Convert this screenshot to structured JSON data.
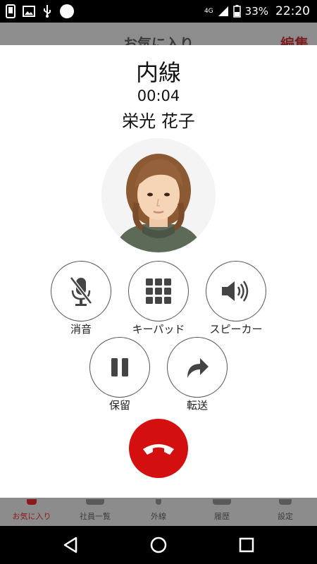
{
  "status_bar": {
    "network": "4G",
    "battery": "33%",
    "time": "22:20"
  },
  "background_app": {
    "title": "お気に入り",
    "edit_label": "編集",
    "nav": [
      {
        "label": "お気に入り",
        "active": true
      },
      {
        "label": "社員一覧",
        "active": false
      },
      {
        "label": "外線",
        "active": false
      },
      {
        "label": "履歴",
        "active": false
      },
      {
        "label": "設定",
        "active": false
      }
    ]
  },
  "call": {
    "line_type": "内線",
    "duration": "00:04",
    "caller_name": "栄光 花子",
    "controls": {
      "mute": "消音",
      "keypad": "キーパッド",
      "speaker": "スピーカー",
      "hold": "保留",
      "transfer": "転送"
    },
    "end_call_color": "#d30f0f"
  }
}
